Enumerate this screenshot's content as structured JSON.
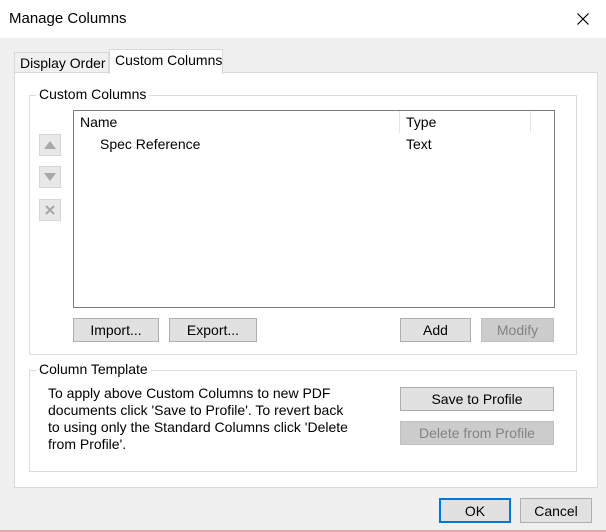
{
  "window": {
    "title": "Manage Columns",
    "close_icon": "close-icon"
  },
  "tabs": [
    {
      "label": "Display Order",
      "active": false
    },
    {
      "label": "Custom Columns",
      "active": true
    }
  ],
  "custom_columns": {
    "group_label": "Custom Columns",
    "side_buttons": [
      "move-up-icon",
      "move-down-icon",
      "delete-icon"
    ],
    "headers": {
      "name": "Name",
      "type": "Type"
    },
    "rows": [
      {
        "name": "Spec Reference",
        "type": "Text"
      }
    ],
    "buttons": {
      "import": "Import...",
      "export": "Export...",
      "add": "Add",
      "modify": "Modify"
    }
  },
  "column_template": {
    "group_label": "Column Template",
    "text": "To apply above Custom Columns to new PDF documents click 'Save to Profile'. To revert back to using only the Standard Columns click 'Delete from Profile'.",
    "save_label": "Save to Profile",
    "delete_label": "Delete from Profile"
  },
  "footer": {
    "ok_label": "OK",
    "cancel_label": "Cancel"
  }
}
